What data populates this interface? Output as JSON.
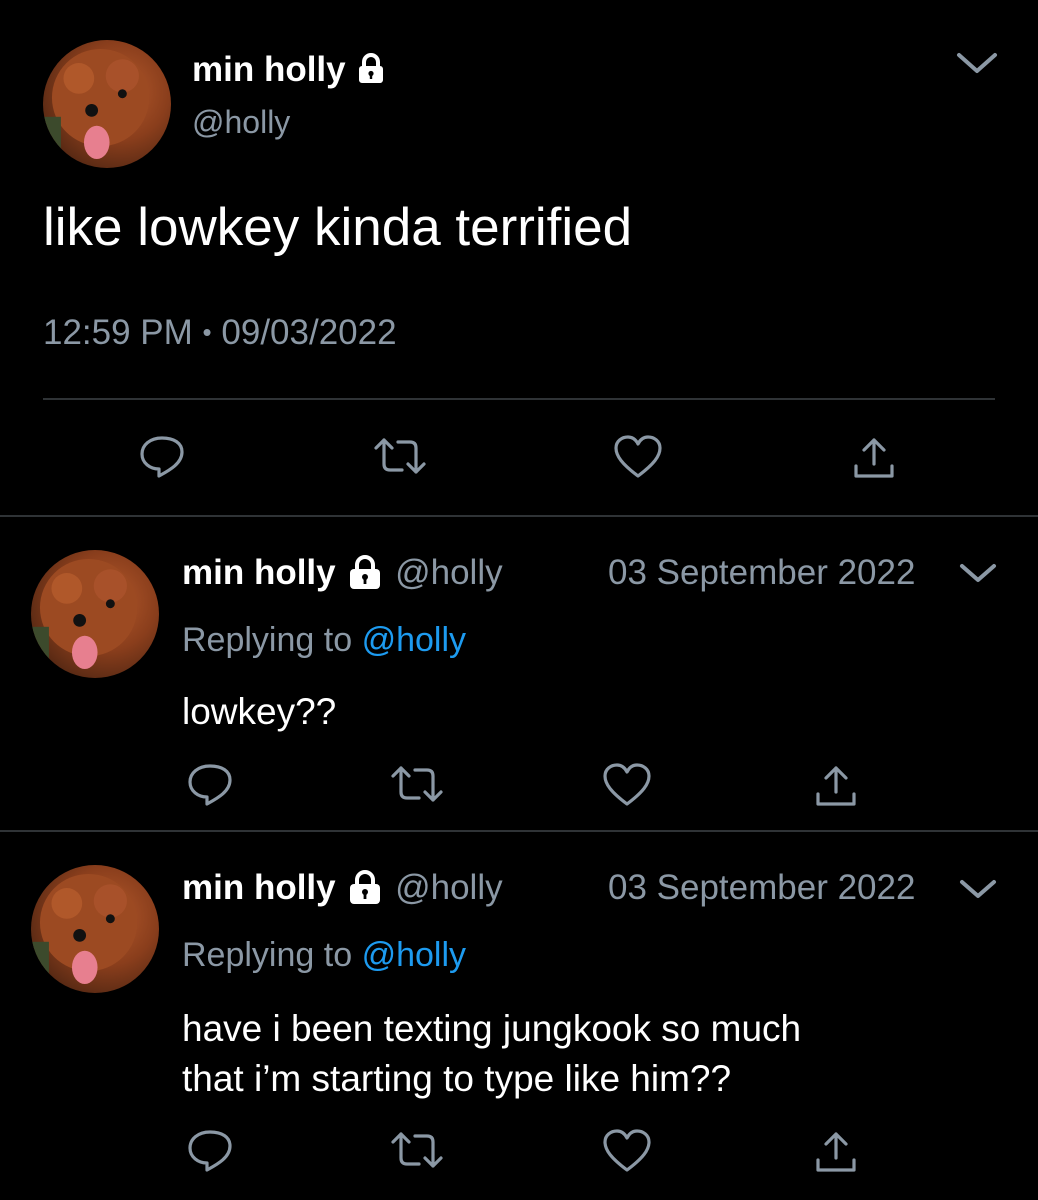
{
  "main_tweet": {
    "display_name": "min holly",
    "handle": "@holly",
    "text": "like lowkey kinda terrified",
    "time": "12:59 PM",
    "separator": "•",
    "date": "09/03/2022"
  },
  "replies": [
    {
      "display_name": "min holly",
      "handle": "@holly",
      "date": "03 September 2022",
      "replying_prefix": "Replying to",
      "replying_handle": "@holly",
      "text_lines": [
        "lowkey??"
      ]
    },
    {
      "display_name": "min holly",
      "handle": "@holly",
      "date": "03 September 2022",
      "replying_prefix": "Replying to",
      "replying_handle": "@holly",
      "text_lines": [
        "have i been texting jungkook so much",
        "that i’m starting to type like him??"
      ]
    }
  ],
  "icons": [
    "lock-icon",
    "chevron-down-icon",
    "reply-icon",
    "retweet-icon",
    "like-icon",
    "share-icon"
  ],
  "colors": {
    "background": "#000000",
    "muted": "#8b98a5",
    "link": "#1d9bf0",
    "divider": "#2f3336"
  }
}
